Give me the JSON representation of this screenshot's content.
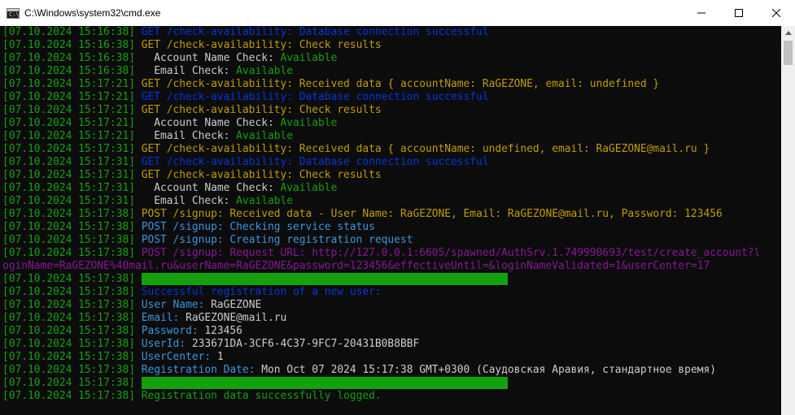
{
  "window": {
    "title": "C:\\Windows\\system32\\cmd.exe",
    "icon_text": "C:\\"
  },
  "lines": [
    {
      "ts": "[07.10.2024 15:16:38]",
      "segs": [
        {
          "t": " GET /check-availability: Database connection successful",
          "c": "blue"
        }
      ]
    },
    {
      "ts": "[07.10.2024 15:16:38]",
      "segs": [
        {
          "t": " GET /check-availability: Check results",
          "c": "yellow"
        }
      ]
    },
    {
      "ts": "[07.10.2024 15:16:38]",
      "segs": [
        {
          "t": "   Account Name Check: ",
          "c": "white"
        },
        {
          "t": "Available",
          "c": "green"
        }
      ]
    },
    {
      "ts": "[07.10.2024 15:16:38]",
      "segs": [
        {
          "t": "   Email Check: ",
          "c": "white"
        },
        {
          "t": "Available",
          "c": "green"
        }
      ]
    },
    {
      "ts": "[07.10.2024 15:17:21]",
      "segs": [
        {
          "t": " GET /check-availability: Received data { accountName: RaGEZONE, email: undefined }",
          "c": "yellow"
        }
      ]
    },
    {
      "ts": "[07.10.2024 15:17:21]",
      "segs": [
        {
          "t": " GET /check-availability: Database connection successful",
          "c": "blue"
        }
      ]
    },
    {
      "ts": "[07.10.2024 15:17:21]",
      "segs": [
        {
          "t": " GET /check-availability: Check results",
          "c": "yellow"
        }
      ]
    },
    {
      "ts": "[07.10.2024 15:17:21]",
      "segs": [
        {
          "t": "   Account Name Check: ",
          "c": "white"
        },
        {
          "t": "Available",
          "c": "green"
        }
      ]
    },
    {
      "ts": "[07.10.2024 15:17:21]",
      "segs": [
        {
          "t": "   Email Check: ",
          "c": "white"
        },
        {
          "t": "Available",
          "c": "green"
        }
      ]
    },
    {
      "ts": "[07.10.2024 15:17:31]",
      "segs": [
        {
          "t": " GET /check-availability: Received data { accountName: undefined, email: RaGEZONE@mail.ru }",
          "c": "yellow"
        }
      ]
    },
    {
      "ts": "[07.10.2024 15:17:31]",
      "segs": [
        {
          "t": " GET /check-availability: Database connection successful",
          "c": "blue"
        }
      ]
    },
    {
      "ts": "[07.10.2024 15:17:31]",
      "segs": [
        {
          "t": " GET /check-availability: Check results",
          "c": "yellow"
        }
      ]
    },
    {
      "ts": "[07.10.2024 15:17:31]",
      "segs": [
        {
          "t": "   Account Name Check: ",
          "c": "white"
        },
        {
          "t": "Available",
          "c": "green"
        }
      ]
    },
    {
      "ts": "[07.10.2024 15:17:31]",
      "segs": [
        {
          "t": "   Email Check: ",
          "c": "white"
        },
        {
          "t": "Available",
          "c": "green"
        }
      ]
    },
    {
      "ts": "[07.10.2024 15:17:38]",
      "segs": [
        {
          "t": " POST /signup: Received data - User Name: RaGEZONE, Email: RaGEZONE@mail.ru, Password: 123456",
          "c": "yellow"
        }
      ]
    },
    {
      "ts": "[07.10.2024 15:17:38]",
      "segs": [
        {
          "t": " POST /signup: Checking service status",
          "c": "cyan"
        }
      ]
    },
    {
      "ts": "[07.10.2024 15:17:38]",
      "segs": [
        {
          "t": " POST /signup: Creating registration request",
          "c": "cyan"
        }
      ]
    },
    {
      "ts": "[07.10.2024 15:17:38]",
      "segs": [
        {
          "t": " POST /signup: Request URL: http://127.0.0.1:6605/spawned/AuthSrv.1.749990693/test/create_account?l",
          "c": "purple"
        }
      ]
    },
    {
      "ts": "",
      "segs": [
        {
          "t": "oginName=RaGEZONE%40mail.ru&userName=RaGEZONE&password=123456&effectiveUntil=&loginNameValidated=1&userCenter=17",
          "c": "purple"
        }
      ]
    },
    {
      "ts": "[07.10.2024 15:17:38]",
      "segs": [
        {
          "t": " ",
          "c": "white"
        },
        {
          "t": "==========================================================",
          "c": "sep"
        }
      ]
    },
    {
      "ts": "[07.10.2024 15:17:38]",
      "segs": [
        {
          "t": " Successful registration of a new user:",
          "c": "blue"
        }
      ]
    },
    {
      "ts": "[07.10.2024 15:17:38]",
      "segs": [
        {
          "t": " User Name: ",
          "c": "cyan"
        },
        {
          "t": "RaGEZONE",
          "c": "white"
        }
      ]
    },
    {
      "ts": "[07.10.2024 15:17:38]",
      "segs": [
        {
          "t": " Email: ",
          "c": "cyan"
        },
        {
          "t": "RaGEZONE@mail.ru",
          "c": "white"
        }
      ]
    },
    {
      "ts": "[07.10.2024 15:17:38]",
      "segs": [
        {
          "t": " Password: ",
          "c": "cyan"
        },
        {
          "t": "123456",
          "c": "white"
        }
      ]
    },
    {
      "ts": "[07.10.2024 15:17:38]",
      "segs": [
        {
          "t": " UserId: ",
          "c": "cyan"
        },
        {
          "t": "233671DA-3CF6-4C37-9FC7-20431B0B8BBF",
          "c": "white"
        }
      ]
    },
    {
      "ts": "[07.10.2024 15:17:38]",
      "segs": [
        {
          "t": " UserCenter: ",
          "c": "cyan"
        },
        {
          "t": "1",
          "c": "white"
        }
      ]
    },
    {
      "ts": "[07.10.2024 15:17:38]",
      "segs": [
        {
          "t": " Registration Date: ",
          "c": "cyan"
        },
        {
          "t": "Mon Oct 07 2024 15:17:38 GMT+0300 (Саудовская Аравия, стандартное время)",
          "c": "white"
        }
      ]
    },
    {
      "ts": "[07.10.2024 15:17:38]",
      "segs": [
        {
          "t": " ",
          "c": "white"
        },
        {
          "t": "==========================================================",
          "c": "sep"
        }
      ]
    },
    {
      "ts": "[07.10.2024 15:17:38]",
      "segs": [
        {
          "t": " Registration data successfully logged.",
          "c": "green"
        }
      ]
    }
  ]
}
